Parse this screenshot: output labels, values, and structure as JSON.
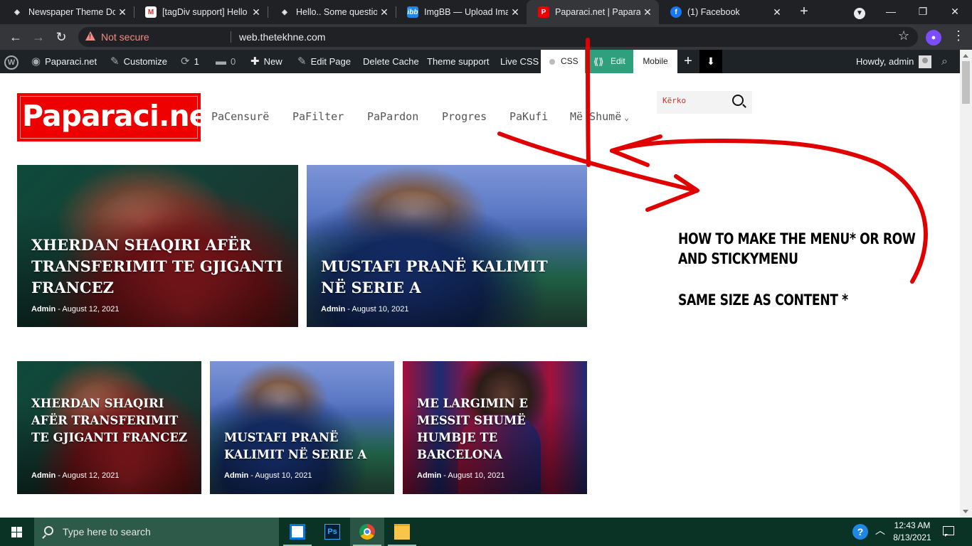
{
  "browser": {
    "tabs": [
      {
        "title": "Newspaper Theme Do",
        "favicon": "tagdiv-icon",
        "active": false
      },
      {
        "title": "[tagDiv support] Hello",
        "favicon": "gmail-icon",
        "active": false
      },
      {
        "title": "Hello.. Some questions",
        "favicon": "tagdiv-icon",
        "active": false
      },
      {
        "title": "ImgBB — Upload Imag",
        "favicon": "imgbb-icon",
        "active": false
      },
      {
        "title": "Paparaci.net | Paparaci",
        "favicon": "paparaci-icon",
        "active": true
      },
      {
        "title": "(1) Facebook",
        "favicon": "facebook-icon",
        "active": false
      }
    ],
    "security_label": "Not secure",
    "url": "web.thetekhne.com",
    "profile_initial": "●"
  },
  "adminbar": {
    "site_name": "Paparaci.net",
    "customize": "Customize",
    "updates_count": "1",
    "comments_count": "0",
    "new": "New",
    "edit_page": "Edit Page",
    "delete_cache": "Delete Cache",
    "theme_support": "Theme support",
    "live_css": "Live CSS",
    "css": "CSS",
    "edit": "Edit",
    "mobile": "Mobile",
    "howdy": "Howdy, admin"
  },
  "site": {
    "logo_text": "Paparaci.net",
    "menu": [
      "PaCensurë",
      "PaFilter",
      "PaPardon",
      "Progres",
      "PaKufi",
      "Më Shumë"
    ],
    "search_placeholder": "Kërko"
  },
  "articles": {
    "big": [
      {
        "title": "Xherdan Shaqiri afër transferimit te gjiganti francez",
        "author": "Admin",
        "date": "August 12, 2021"
      },
      {
        "title": "Mustafi pranë kalimit në Serie A",
        "author": "Admin",
        "date": "August 10, 2021"
      }
    ],
    "small": [
      {
        "title": "Xherdan Shaqiri afër transferimit te gjiganti francez",
        "author": "Admin",
        "date": "August 12, 2021"
      },
      {
        "title": "Mustafi pranë kalimit në Serie A",
        "author": "Admin",
        "date": "August 10, 2021"
      },
      {
        "title": "Me largimin e Messit shumë humbje te Barcelona",
        "author": "Admin",
        "date": "August 10, 2021"
      }
    ]
  },
  "annotation": {
    "line1": "How to make the menu* or  row",
    "line2": "and stickymenu",
    "line3": "same size as content *"
  },
  "taskbar": {
    "search_placeholder": "Type here to search",
    "time": "12:43 AM",
    "date": "8/13/2021"
  },
  "colors": {
    "brand_red": "#ee0000",
    "admin_bar": "#1d2327",
    "edit_green": "#2ea07b",
    "annotation_pen": "#e00000"
  }
}
